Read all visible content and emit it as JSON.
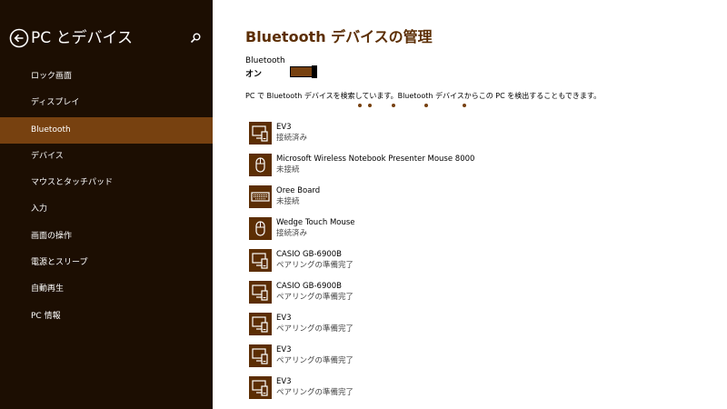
{
  "sidebar": {
    "title": "PC とデバイス",
    "back_icon": "back-arrow-circle-icon",
    "search_icon": "search-icon",
    "items": [
      {
        "label": "ロック画面"
      },
      {
        "label": "ディスプレイ"
      },
      {
        "label": "Bluetooth",
        "active": true
      },
      {
        "label": "デバイス"
      },
      {
        "label": "マウスとタッチパッド"
      },
      {
        "label": "入力"
      },
      {
        "label": "画面の操作"
      },
      {
        "label": "電源とスリープ"
      },
      {
        "label": "自動再生"
      },
      {
        "label": "PC 情報"
      }
    ]
  },
  "main": {
    "title": "Bluetooth デバイスの管理",
    "bluetooth_label": "Bluetooth",
    "bluetooth_state": "オン",
    "toggle_on": true,
    "info": "PC で Bluetooth デバイスを検索しています。Bluetooth デバイスからこの PC を検出することもできます。",
    "devices": [
      {
        "name": "EV3",
        "status": "接続済み",
        "icon": "phone-pc-device-icon"
      },
      {
        "name": "Microsoft Wireless Notebook Presenter Mouse 8000",
        "status": "未接続",
        "icon": "mouse-icon"
      },
      {
        "name": "Oree Board",
        "status": "未接続",
        "icon": "keyboard-icon"
      },
      {
        "name": "Wedge Touch Mouse",
        "status": "接続済み",
        "icon": "mouse-icon"
      },
      {
        "name": "CASIO GB-6900B",
        "status": "ペアリングの準備完了",
        "icon": "phone-pc-device-icon"
      },
      {
        "name": "CASIO GB-6900B",
        "status": "ペアリングの準備完了",
        "icon": "phone-pc-device-icon"
      },
      {
        "name": "EV3",
        "status": "ペアリングの準備完了",
        "icon": "phone-pc-device-icon"
      },
      {
        "name": "EV3",
        "status": "ペアリングの準備完了",
        "icon": "phone-pc-device-icon"
      },
      {
        "name": "EV3",
        "status": "ペアリングの準備完了",
        "icon": "phone-pc-device-icon"
      }
    ]
  },
  "colors": {
    "sidebar_bg": "#1c0e02",
    "accent": "#774110",
    "title": "#5c2e04",
    "icon_bg": "#5c2e04"
  }
}
